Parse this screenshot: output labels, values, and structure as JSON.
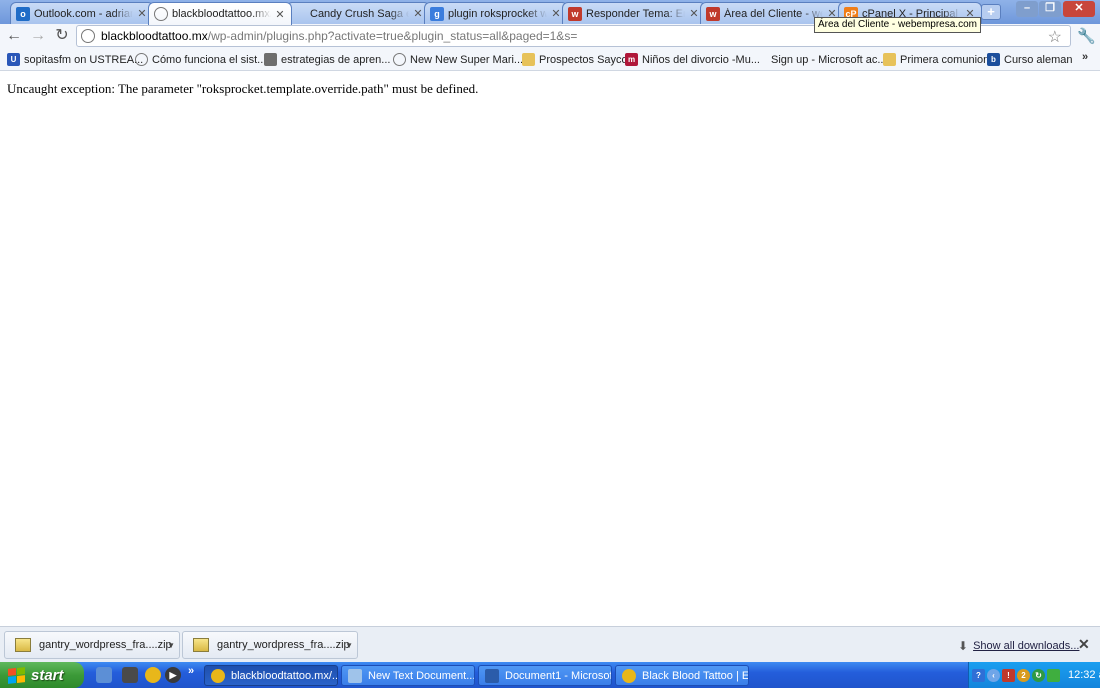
{
  "browser": {
    "tabs": [
      {
        "title": "Outlook.com - adriana_",
        "favicon": "outlook-icon",
        "favicon_text": "o",
        "favicon_color": "#1f6cc7",
        "active": false
      },
      {
        "title": "blackbloodtattoo.mx/wp",
        "favicon": "globe-icon",
        "favicon_text": "",
        "favicon_color": "#ffffff",
        "active": true
      },
      {
        "title": "Candy Crush Saga en F",
        "favicon": "candy-crush-icon",
        "favicon_text": "",
        "favicon_color": "#d23a3a",
        "active": false
      },
      {
        "title": "plugin roksprocket web",
        "favicon": "google-search-icon",
        "favicon_text": "g",
        "favicon_color": "#3b7ddd",
        "active": false
      },
      {
        "title": "Responder Tema: Error",
        "favicon": "webempresa-icon",
        "favicon_text": "w",
        "favicon_color": "#c0392b",
        "active": false
      },
      {
        "title": "Área del Cliente - webe",
        "favicon": "webempresa-icon",
        "favicon_text": "w",
        "favicon_color": "#c0392b",
        "active": false
      },
      {
        "title": "cPanel X - Principal",
        "favicon": "cpanel-icon",
        "favicon_text": "cP",
        "favicon_color": "#f07e18",
        "active": false
      }
    ],
    "tooltip": "Área del Cliente - webempresa.com",
    "url_host": "blackbloodtattoo.mx",
    "url_path": "/wp-admin/plugins.php?activate=true&plugin_status=all&paged=1&s=",
    "bookmarks": [
      {
        "label": "sopitasfm on USTREA...",
        "icon": "ustream-icon",
        "icon_text": "U",
        "color": "#2a57b8"
      },
      {
        "label": "Cómo funciona el sist...",
        "icon": "globe-icon",
        "icon_text": "",
        "color": "#8a8a8a"
      },
      {
        "label": "estrategias de apren...",
        "icon": "document-icon",
        "icon_text": "",
        "color": "#6e6e6e"
      },
      {
        "label": "New New Super Mari...",
        "icon": "globe-icon",
        "icon_text": "",
        "color": "#8a8a8a"
      },
      {
        "label": "Prospectos Sayco",
        "icon": "folder-icon",
        "icon_text": "",
        "color": "#e7c25a"
      },
      {
        "label": "Niños del divorcio -Mu...",
        "icon": "m-logo-icon",
        "icon_text": "m",
        "color": "#b0183a"
      },
      {
        "label": "Sign up - Microsoft ac...",
        "icon": "microsoft-icon",
        "icon_text": "",
        "color": "#f25022"
      },
      {
        "label": "Primera comunion",
        "icon": "folder-icon",
        "icon_text": "",
        "color": "#e7c25a"
      },
      {
        "label": "Curso aleman",
        "icon": "b-logo-icon",
        "icon_text": "b",
        "color": "#1c4f9c"
      }
    ],
    "bookmarks_overflow": "»"
  },
  "page": {
    "error_message": "Uncaught exception: The parameter \"roksprocket.template.override.path\" must be defined."
  },
  "downloads": {
    "items": [
      {
        "name": "gantry_wordpress_fra....zip"
      },
      {
        "name": "gantry_wordpress_fra....zip"
      }
    ],
    "show_all_label": "Show all downloads...",
    "close_symbol": "✕"
  },
  "taskbar": {
    "start_label": "start",
    "quick_launch": [
      {
        "name": "show-desktop-icon",
        "text": "",
        "color": "#5c8fd6"
      },
      {
        "name": "dvd-icon",
        "text": "",
        "color": "#4a4a4a"
      },
      {
        "name": "chrome-icon",
        "text": "",
        "color": "#e8b71a"
      },
      {
        "name": "media-player-icon",
        "text": "▶",
        "color": "#3a3a3a"
      }
    ],
    "quick_launch_more": "»",
    "tasks": [
      {
        "label": "blackbloodtattoo.mx/...",
        "icon": "chrome-icon",
        "color": "#e8b71a",
        "active": true
      },
      {
        "label": "New Text Document....",
        "icon": "notepad-icon",
        "color": "#9fc3ea",
        "active": false
      },
      {
        "label": "Document1 - Microsof...",
        "icon": "word-icon",
        "color": "#2b5caa",
        "active": false
      },
      {
        "label": "Black Blood Tattoo | E...",
        "icon": "chrome-icon",
        "color": "#e8b71a",
        "active": false
      }
    ],
    "tray_icons": [
      {
        "name": "help-icon",
        "text": "?",
        "color": "#2f6fd6"
      },
      {
        "name": "back-arrow-icon",
        "text": "‹",
        "color": "#6fa5e8"
      },
      {
        "name": "antivirus-icon",
        "text": "!",
        "color": "#c0392b"
      },
      {
        "name": "notification-icon",
        "text": "2",
        "color": "#d89b1c"
      },
      {
        "name": "update-icon",
        "text": "↻",
        "color": "#2f9a42"
      },
      {
        "name": "wifi-icon",
        "text": "",
        "color": "#3fae3f"
      }
    ],
    "clock": "12:32 a.m."
  }
}
